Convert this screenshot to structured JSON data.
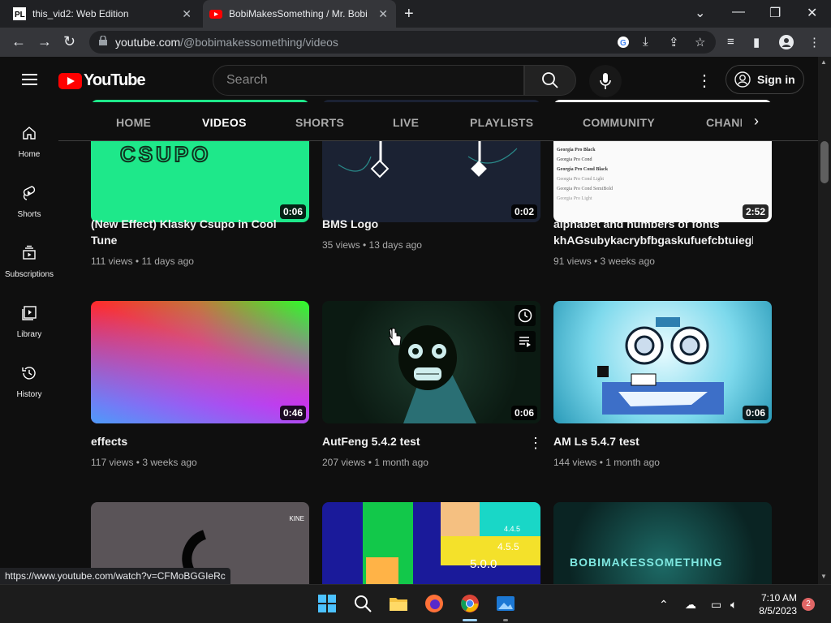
{
  "browser": {
    "tabs": [
      {
        "title": "this_vid2: Web Edition",
        "favicon": "pl-icon"
      },
      {
        "title": "BobiMakesSomething / Mr. Bobi",
        "favicon": "youtube-icon"
      }
    ],
    "url_host": "youtube.com",
    "url_path": "/@bobimakessomething/videos",
    "status_url": "https://www.youtube.com/watch?v=CFMoBGGIeRc"
  },
  "youtube": {
    "logo_text": "YouTube",
    "search_placeholder": "Search",
    "signin_label": "Sign in",
    "sidebar": [
      {
        "label": "Home",
        "icon": "home-icon"
      },
      {
        "label": "Shorts",
        "icon": "shorts-icon"
      },
      {
        "label": "Subscriptions",
        "icon": "subscriptions-icon"
      },
      {
        "label": "Library",
        "icon": "library-icon"
      },
      {
        "label": "History",
        "icon": "history-icon"
      }
    ],
    "channel_tabs": [
      "HOME",
      "VIDEOS",
      "SHORTS",
      "LIVE",
      "PLAYLISTS",
      "COMMUNITY",
      "CHANI"
    ],
    "active_tab": "VIDEOS",
    "videos": [
      {
        "title": "(New Effect) Klasky Csupo in Cool Tune",
        "meta": "111 views • 11 days ago",
        "duration": "0:06"
      },
      {
        "title": "BMS Logo",
        "meta": "35 views • 13 days ago",
        "duration": "0:02"
      },
      {
        "title": "alphabet and numbers of fonts khAGsubykacrybfbgaskufuefcbtuiegbfi",
        "meta": "91 views • 3 weeks ago",
        "duration": "2:52"
      },
      {
        "title": "effects",
        "meta": "117 views • 3 weeks ago",
        "duration": "0:46"
      },
      {
        "title": "AutFeng 5.4.2 test",
        "meta": "207 views • 1 month ago",
        "duration": "0:06"
      },
      {
        "title": "AM Ls 5.4.7 test",
        "meta": "144 views • 1 month ago",
        "duration": "0:06"
      }
    ],
    "thumb_text": {
      "csupo": "CSUPO",
      "fonts": [
        "Georgia Pro Black",
        "Georgia Pro Cond",
        "Georgia Pro Cond Black",
        "Georgia Pro Cond Light",
        "Georgia Pro Cond SemiBold",
        "Georgia Pro Light"
      ],
      "kine": "KINE",
      "numbers": [
        "4.4.5",
        "4.5.5",
        "5.0.0"
      ],
      "bms": "BOBIMAKESSOMETHING"
    }
  },
  "taskbar": {
    "time": "7:10 AM",
    "date": "8/5/2023",
    "notifications": "2"
  }
}
